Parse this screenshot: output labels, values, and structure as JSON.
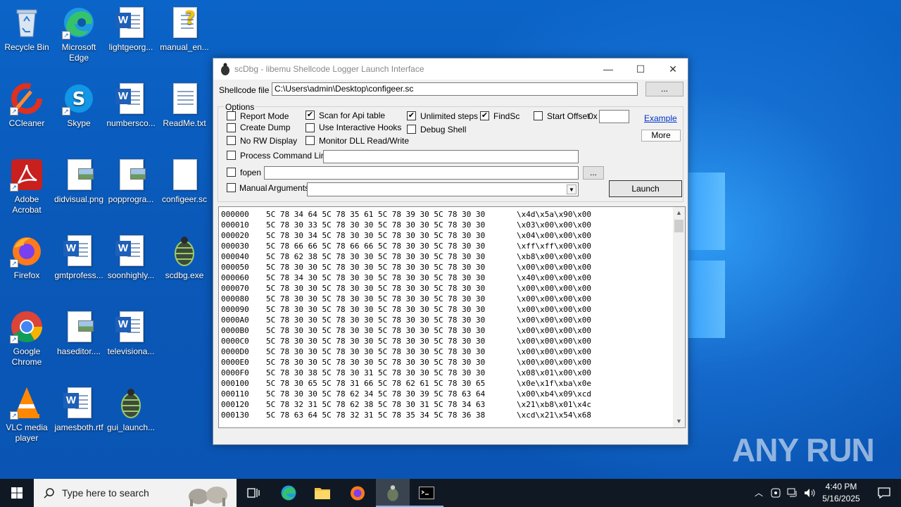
{
  "desktop": {
    "icons": [
      {
        "label": "Recycle Bin"
      },
      {
        "label": "Microsoft Edge"
      },
      {
        "label": "lightgeorg..."
      },
      {
        "label": "manual_en..."
      },
      {
        "label": "CCleaner"
      },
      {
        "label": "Skype"
      },
      {
        "label": "numbersco..."
      },
      {
        "label": "ReadMe.txt"
      },
      {
        "label": "Adobe Acrobat"
      },
      {
        "label": "didvisual.png"
      },
      {
        "label": "popprogra..."
      },
      {
        "label": "configeer.sc"
      },
      {
        "label": "Firefox"
      },
      {
        "label": "gmtprofess..."
      },
      {
        "label": "soonhighly..."
      },
      {
        "label": "scdbg.exe"
      },
      {
        "label": "Google Chrome"
      },
      {
        "label": "haseditor...."
      },
      {
        "label": "televisiona..."
      },
      {
        "label": "VLC media player"
      },
      {
        "label": "jamesboth.rtf"
      },
      {
        "label": "gui_launch..."
      }
    ]
  },
  "window": {
    "title": "scDbg - libemu Shellcode Logger Launch Interface",
    "shellcode_label": "Shellcode file",
    "shellcode_path": "C:\\Users\\admin\\Desktop\\configeer.sc",
    "browse_label": "...",
    "options_label": "Options",
    "opt_report_mode": "Report Mode",
    "opt_create_dump": "Create Dump",
    "opt_no_rw": "No RW Display",
    "opt_scan_api": "Scan for Api table",
    "opt_interactive_hooks": "Use Interactive Hooks",
    "opt_monitor_dll": "Monitor DLL Read/Write",
    "opt_unlimited_steps": "Unlimited steps",
    "opt_debug_shell": "Debug Shell",
    "opt_findsc": "FindSc",
    "opt_start_offset": "Start Offset",
    "offset_prefix": "0x",
    "example_link": "Example",
    "more_button": "More",
    "process_cmdline": "Process Command Line",
    "fopen_label": "fopen",
    "fopen_browse": "...",
    "manual_label": "Manual",
    "arguments_label": "Arguments",
    "launch_button": "Launch",
    "checked": {
      "scan_api": true,
      "unlimited_steps": true,
      "findsc": true
    }
  },
  "hexdump": [
    {
      "off": "000000",
      "bytes": "5C 78 34 64 5C 78 35 61 5C 78 39 30 5C 78 30 30",
      "ascii": "\\x4d\\x5a\\x90\\x00"
    },
    {
      "off": "000010",
      "bytes": "5C 78 30 33 5C 78 30 30 5C 78 30 30 5C 78 30 30",
      "ascii": "\\x03\\x00\\x00\\x00"
    },
    {
      "off": "000020",
      "bytes": "5C 78 30 34 5C 78 30 30 5C 78 30 30 5C 78 30 30",
      "ascii": "\\x04\\x00\\x00\\x00"
    },
    {
      "off": "000030",
      "bytes": "5C 78 66 66 5C 78 66 66 5C 78 30 30 5C 78 30 30",
      "ascii": "\\xff\\xff\\x00\\x00"
    },
    {
      "off": "000040",
      "bytes": "5C 78 62 38 5C 78 30 30 5C 78 30 30 5C 78 30 30",
      "ascii": "\\xb8\\x00\\x00\\x00"
    },
    {
      "off": "000050",
      "bytes": "5C 78 30 30 5C 78 30 30 5C 78 30 30 5C 78 30 30",
      "ascii": "\\x00\\x00\\x00\\x00"
    },
    {
      "off": "000060",
      "bytes": "5C 78 34 30 5C 78 30 30 5C 78 30 30 5C 78 30 30",
      "ascii": "\\x40\\x00\\x00\\x00"
    },
    {
      "off": "000070",
      "bytes": "5C 78 30 30 5C 78 30 30 5C 78 30 30 5C 78 30 30",
      "ascii": "\\x00\\x00\\x00\\x00"
    },
    {
      "off": "000080",
      "bytes": "5C 78 30 30 5C 78 30 30 5C 78 30 30 5C 78 30 30",
      "ascii": "\\x00\\x00\\x00\\x00"
    },
    {
      "off": "000090",
      "bytes": "5C 78 30 30 5C 78 30 30 5C 78 30 30 5C 78 30 30",
      "ascii": "\\x00\\x00\\x00\\x00"
    },
    {
      "off": "0000A0",
      "bytes": "5C 78 30 30 5C 78 30 30 5C 78 30 30 5C 78 30 30",
      "ascii": "\\x00\\x00\\x00\\x00"
    },
    {
      "off": "0000B0",
      "bytes": "5C 78 30 30 5C 78 30 30 5C 78 30 30 5C 78 30 30",
      "ascii": "\\x00\\x00\\x00\\x00"
    },
    {
      "off": "0000C0",
      "bytes": "5C 78 30 30 5C 78 30 30 5C 78 30 30 5C 78 30 30",
      "ascii": "\\x00\\x00\\x00\\x00"
    },
    {
      "off": "0000D0",
      "bytes": "5C 78 30 30 5C 78 30 30 5C 78 30 30 5C 78 30 30",
      "ascii": "\\x00\\x00\\x00\\x00"
    },
    {
      "off": "0000E0",
      "bytes": "5C 78 30 30 5C 78 30 30 5C 78 30 30 5C 78 30 30",
      "ascii": "\\x00\\x00\\x00\\x00"
    },
    {
      "off": "0000F0",
      "bytes": "5C 78 30 38 5C 78 30 31 5C 78 30 30 5C 78 30 30",
      "ascii": "\\x08\\x01\\x00\\x00"
    },
    {
      "off": "000100",
      "bytes": "5C 78 30 65 5C 78 31 66 5C 78 62 61 5C 78 30 65",
      "ascii": "\\x0e\\x1f\\xba\\x0e"
    },
    {
      "off": "000110",
      "bytes": "5C 78 30 30 5C 78 62 34 5C 78 30 39 5C 78 63 64",
      "ascii": "\\x00\\xb4\\x09\\xcd"
    },
    {
      "off": "000120",
      "bytes": "5C 78 32 31 5C 78 62 38 5C 78 30 31 5C 78 34 63",
      "ascii": "\\x21\\xb8\\x01\\x4c"
    },
    {
      "off": "000130",
      "bytes": "5C 78 63 64 5C 78 32 31 5C 78 35 34 5C 78 36 38",
      "ascii": "\\xcd\\x21\\x54\\x68"
    }
  ],
  "taskbar": {
    "search_placeholder": "Type here to search",
    "time": "4:40 PM",
    "date": "5/16/2025"
  },
  "watermark": "ANY RUN"
}
